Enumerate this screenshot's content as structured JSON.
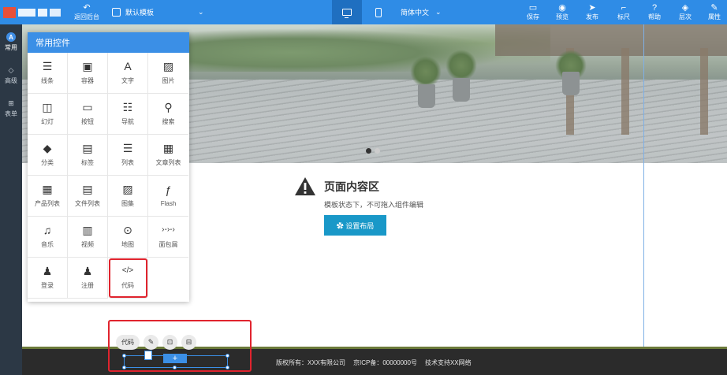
{
  "topbar": {
    "back_label": "返回后台",
    "template_label": "默认模板",
    "language_label": "简体中文",
    "actions": [
      {
        "label": "保存",
        "icon": "save-icon",
        "glyph": "▭"
      },
      {
        "label": "预览",
        "icon": "eye-icon",
        "glyph": "◉"
      },
      {
        "label": "发布",
        "icon": "send-icon",
        "glyph": "➤"
      },
      {
        "label": "标尺",
        "icon": "ruler-icon",
        "glyph": "⌐"
      },
      {
        "label": "帮助",
        "icon": "help-icon",
        "glyph": "?"
      },
      {
        "label": "层次",
        "icon": "layers-icon",
        "glyph": "◈"
      },
      {
        "label": "属性",
        "icon": "properties-icon",
        "glyph": "✎"
      }
    ]
  },
  "rail": {
    "items": [
      {
        "label": "常用",
        "icon": "common-icon",
        "glyph": "A",
        "active": true
      },
      {
        "label": "高级",
        "icon": "diamond-icon",
        "glyph": "◇",
        "active": false
      },
      {
        "label": "表单",
        "icon": "form-grid-icon",
        "glyph": "⊞",
        "active": false
      }
    ]
  },
  "panel": {
    "title": "常用控件",
    "widgets": [
      {
        "label": "线条",
        "icon": "lines-icon",
        "glyph": "☰"
      },
      {
        "label": "容器",
        "icon": "container-icon",
        "glyph": "▣"
      },
      {
        "label": "文字",
        "icon": "text-icon",
        "glyph": "A"
      },
      {
        "label": "图片",
        "icon": "image-icon",
        "glyph": "▨"
      },
      {
        "label": "幻灯",
        "icon": "slideshow-icon",
        "glyph": "◫"
      },
      {
        "label": "按钮",
        "icon": "button-icon",
        "glyph": "▭"
      },
      {
        "label": "导航",
        "icon": "nav-icon",
        "glyph": "☷"
      },
      {
        "label": "搜索",
        "icon": "search-icon",
        "glyph": "⚲"
      },
      {
        "label": "分类",
        "icon": "category-stack-icon",
        "glyph": "◆"
      },
      {
        "label": "标签",
        "icon": "tag-icon",
        "glyph": "▤"
      },
      {
        "label": "列表",
        "icon": "list-icon",
        "glyph": "☰"
      },
      {
        "label": "文章列表",
        "icon": "article-list-icon",
        "glyph": "▦"
      },
      {
        "label": "产品列表",
        "icon": "product-list-icon",
        "glyph": "▦"
      },
      {
        "label": "文件列表",
        "icon": "file-list-icon",
        "glyph": "▤"
      },
      {
        "label": "图集",
        "icon": "gallery-icon",
        "glyph": "▨"
      },
      {
        "label": "Flash",
        "icon": "flash-icon",
        "glyph": "ƒ"
      },
      {
        "label": "音乐",
        "icon": "music-icon",
        "glyph": "♫"
      },
      {
        "label": "视频",
        "icon": "video-icon",
        "glyph": "▥"
      },
      {
        "label": "地图",
        "icon": "map-pin-icon",
        "glyph": "⊙"
      },
      {
        "label": "面包屑",
        "icon": "breadcrumb-icon",
        "glyph": "›-›-›"
      },
      {
        "label": "登录",
        "icon": "login-user-icon",
        "glyph": "♟"
      },
      {
        "label": "注册",
        "icon": "register-user-icon",
        "glyph": "♟"
      },
      {
        "label": "代码",
        "icon": "code-icon",
        "glyph": "</>"
      }
    ]
  },
  "page_content": {
    "title": "页面内容区",
    "subtitle": "模板状态下，不可拖入组件编辑",
    "button_label": "✿ 设置布局"
  },
  "footer": {
    "copyright": "版权所有：XXX有限公司",
    "icp": "京ICP备：00000000号",
    "support": "技术支持XX网络"
  },
  "selection_toolbar": {
    "label": "代码",
    "buttons": [
      {
        "icon": "wrench-icon",
        "glyph": "✎"
      },
      {
        "icon": "unlock-icon",
        "glyph": "⊡"
      },
      {
        "icon": "trash-icon",
        "glyph": "⊟"
      }
    ]
  },
  "colors": {
    "topbar": "#2f8ce6",
    "rail": "#2c3845",
    "accent_button": "#1998c8",
    "highlight": "#e0242e",
    "footer": "#2b2b2b"
  }
}
